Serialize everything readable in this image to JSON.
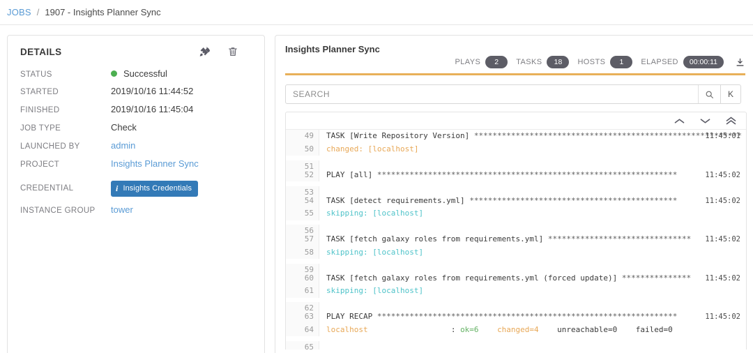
{
  "breadcrumb": {
    "root": "JOBS",
    "separator": "/",
    "current": "1907 - Insights Planner Sync"
  },
  "details": {
    "title": "DETAILS",
    "actions": [
      {
        "name": "relaunch-icon",
        "label": "Relaunch"
      },
      {
        "name": "delete-icon",
        "label": "Delete"
      }
    ],
    "rows": [
      {
        "label": "STATUS",
        "value": "Successful",
        "type": "status",
        "color": "#4caf50"
      },
      {
        "label": "STARTED",
        "value": "2019/10/16 11:44:52",
        "type": "text"
      },
      {
        "label": "FINISHED",
        "value": "2019/10/16 11:45:04",
        "type": "text"
      },
      {
        "label": "JOB TYPE",
        "value": "Check",
        "type": "text"
      },
      {
        "label": "LAUNCHED BY",
        "value": "admin",
        "type": "link"
      },
      {
        "label": "PROJECT",
        "value": "Insights Planner Sync",
        "type": "link"
      },
      {
        "label": "CREDENTIAL",
        "value": "Insights Credentials",
        "type": "badge"
      },
      {
        "label": "INSTANCE GROUP",
        "value": "tower",
        "type": "link"
      }
    ]
  },
  "output": {
    "title": "Insights Planner Sync",
    "stats": [
      {
        "label": "PLAYS",
        "value": "2"
      },
      {
        "label": "TASKS",
        "value": "18"
      },
      {
        "label": "HOSTS",
        "value": "1"
      },
      {
        "label": "ELAPSED",
        "value": "00:00:11"
      }
    ],
    "download_label": "Download Output",
    "accent_color": "#e8b059",
    "search": {
      "placeholder": "SEARCH",
      "value": "",
      "key_label": "K"
    },
    "toolbar": [
      {
        "name": "scroll-up-icon"
      },
      {
        "name": "scroll-down-icon"
      },
      {
        "name": "scroll-top-icon"
      }
    ],
    "lines": [
      {
        "num": "49",
        "time": "11:45:01",
        "parts": [
          {
            "t": "TASK [Write Repository Version] ",
            "c": "plain"
          },
          {
            "t": "**********************************************************",
            "c": "stars"
          }
        ]
      },
      {
        "num": "50",
        "time": "",
        "parts": [
          {
            "t": "changed: [localhost]",
            "c": "changed"
          }
        ]
      },
      {
        "num": "51",
        "time": "",
        "parts": []
      },
      {
        "num": "52",
        "time": "11:45:02",
        "parts": [
          {
            "t": "PLAY [all] ",
            "c": "plain"
          },
          {
            "t": "*****************************************************************",
            "c": "stars"
          }
        ]
      },
      {
        "num": "53",
        "time": "",
        "parts": []
      },
      {
        "num": "54",
        "time": "11:45:02",
        "parts": [
          {
            "t": "TASK [detect requirements.yml] ",
            "c": "plain"
          },
          {
            "t": "*********************************************",
            "c": "stars"
          }
        ]
      },
      {
        "num": "55",
        "time": "",
        "parts": [
          {
            "t": "skipping: [localhost]",
            "c": "skip"
          }
        ]
      },
      {
        "num": "56",
        "time": "",
        "parts": []
      },
      {
        "num": "57",
        "time": "11:45:02",
        "parts": [
          {
            "t": "TASK [fetch galaxy roles from requirements.yml] ",
            "c": "plain"
          },
          {
            "t": "*******************************",
            "c": "stars"
          }
        ]
      },
      {
        "num": "58",
        "time": "",
        "parts": [
          {
            "t": "skipping: [localhost]",
            "c": "skip"
          }
        ]
      },
      {
        "num": "59",
        "time": "",
        "parts": []
      },
      {
        "num": "60",
        "time": "11:45:02",
        "parts": [
          {
            "t": "TASK [fetch galaxy roles from requirements.yml (forced update)] ",
            "c": "plain"
          },
          {
            "t": "***************",
            "c": "stars"
          }
        ]
      },
      {
        "num": "61",
        "time": "",
        "parts": [
          {
            "t": "skipping: [localhost]",
            "c": "skip"
          }
        ]
      },
      {
        "num": "62",
        "time": "",
        "parts": []
      },
      {
        "num": "63",
        "time": "11:45:02",
        "parts": [
          {
            "t": "PLAY RECAP ",
            "c": "plain"
          },
          {
            "t": "*****************************************************************",
            "c": "stars"
          }
        ]
      },
      {
        "num": "64",
        "time": "",
        "parts": [
          {
            "t": "localhost",
            "c": "changed"
          },
          {
            "t": "                  : ",
            "c": "plain"
          },
          {
            "t": "ok=6",
            "c": "ok"
          },
          {
            "t": "    ",
            "c": "plain"
          },
          {
            "t": "changed=4",
            "c": "changed"
          },
          {
            "t": "    unreachable=0    failed=0",
            "c": "plain"
          }
        ]
      },
      {
        "num": "65",
        "time": "",
        "parts": []
      }
    ]
  }
}
